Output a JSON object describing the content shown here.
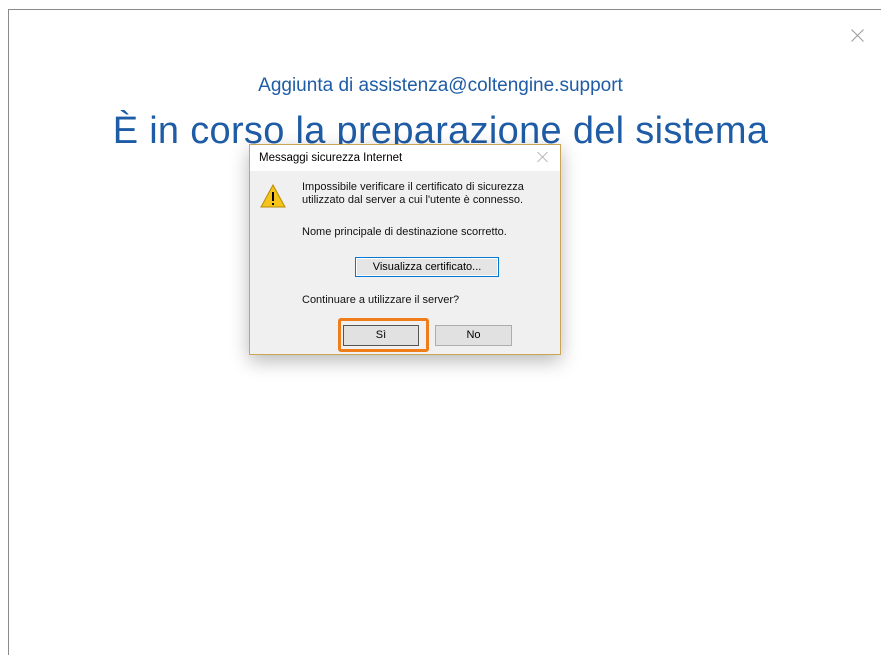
{
  "window": {
    "subtitle": "Aggiunta di assistenza@coltengine.support",
    "headline": "È in corso la preparazione del sistema"
  },
  "dialog": {
    "title": "Messaggi sicurezza Internet",
    "message_line1": "Impossibile verificare il certificato di sicurezza",
    "message_line2": "utilizzato dal server a cui l'utente è connesso.",
    "message_reason": "Nome principale di destinazione scorretto.",
    "view_certificate_label": "Visualizza certificato...",
    "question": "Continuare a utilizzare il server?",
    "yes_label": "Sì",
    "no_label": "No"
  },
  "icons": {
    "window_close": "close-icon",
    "dialog_close": "close-icon",
    "warning": "warning-icon"
  },
  "colors": {
    "heading_blue": "#1f5ca6",
    "highlight_orange": "#ef7e1a",
    "warning_yellow": "#f6c31b"
  }
}
